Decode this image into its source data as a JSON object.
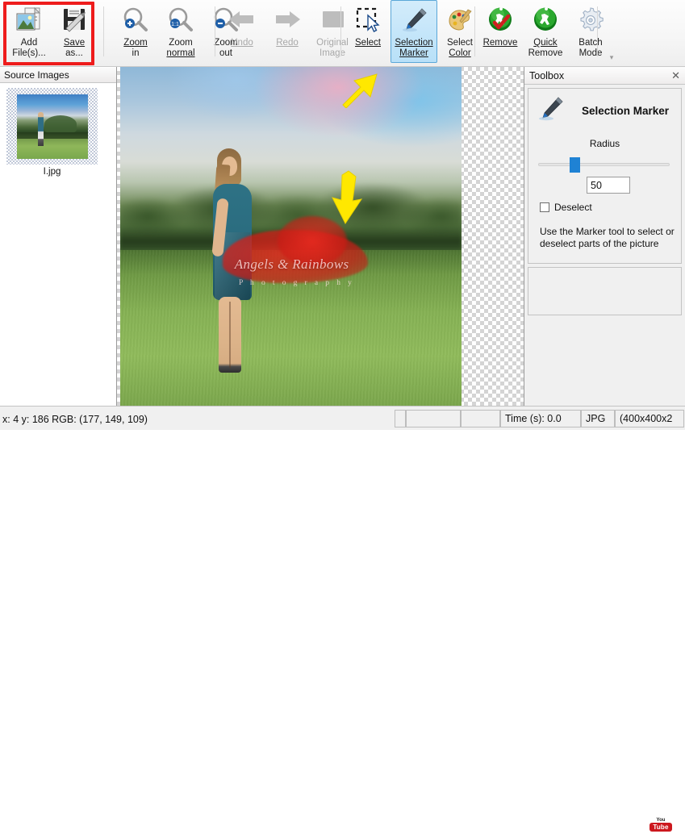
{
  "toolbar": {
    "buttons": [
      {
        "name": "add-files",
        "label1": "Add",
        "label2": "File(s)...",
        "icon": "add-image-icon",
        "state": "normal"
      },
      {
        "name": "save-as",
        "label1": "Save",
        "label2": "as...",
        "icon": "floppy-disk-icon",
        "state": "normal"
      },
      {
        "name": "zoom-in",
        "label1": "Zoom",
        "label2": "in",
        "icon": "magnifier-plus-icon",
        "state": "normal"
      },
      {
        "name": "zoom-normal",
        "label1": "Zoom",
        "label2": "normal",
        "icon": "magnifier-normal-icon",
        "state": "normal"
      },
      {
        "name": "zoom-out",
        "label1": "Zoom",
        "label2": "out",
        "icon": "magnifier-minus-icon",
        "state": "normal"
      },
      {
        "name": "undo",
        "label1": "Undo",
        "label2": "",
        "icon": "undo-arrow-icon",
        "state": "disabled"
      },
      {
        "name": "redo",
        "label1": "Redo",
        "label2": "",
        "icon": "redo-arrow-icon",
        "state": "disabled"
      },
      {
        "name": "original-image",
        "label1": "Original",
        "label2": "Image",
        "icon": "image-placeholder-icon",
        "state": "disabled"
      },
      {
        "name": "select",
        "label1": "Select",
        "label2": "",
        "icon": "marquee-cursor-icon",
        "state": "normal"
      },
      {
        "name": "selection-marker",
        "label1": "Selection",
        "label2": "Marker",
        "icon": "marker-pen-icon",
        "state": "active"
      },
      {
        "name": "select-color",
        "label1": "Select",
        "label2": "Color",
        "icon": "color-palette-icon",
        "state": "normal"
      },
      {
        "name": "remove",
        "label1": "Remove",
        "label2": "",
        "icon": "green-runner-check-icon",
        "state": "normal"
      },
      {
        "name": "quick-remove",
        "label1": "Quick",
        "label2": "Remove",
        "icon": "green-runner-icon",
        "state": "normal"
      },
      {
        "name": "batch-mode",
        "label1": "Batch",
        "label2": "Mode",
        "icon": "gear-icon",
        "state": "normal"
      }
    ],
    "overflow_glyph": "▾",
    "highlight_color": "#ee1c1c"
  },
  "left_panel": {
    "title": "Source Images",
    "items": [
      {
        "filename": "I.jpg"
      }
    ]
  },
  "canvas": {
    "watermark_line1": "Angels & Rainbows",
    "watermark_line2": "P h o t o g r a p h y"
  },
  "right_panel": {
    "title": "Toolbox",
    "close_glyph": "✕",
    "tool_title": "Selection Marker",
    "tool_icon": "marker-pen-icon",
    "radius_label": "Radius",
    "radius_value": "50",
    "slider_percent": 24,
    "deselect_label": "Deselect",
    "deselect_checked": false,
    "hint_line1": "Use the Marker tool to select or",
    "hint_line2": "deselect parts of the picture"
  },
  "statusbar": {
    "coords": "x: 4 y: 186  RGB: (177, 149, 109)",
    "cells": [
      {
        "name": "status-cell-1",
        "text": ""
      },
      {
        "name": "status-cell-2",
        "text": ""
      },
      {
        "name": "status-cell-3",
        "text": ""
      },
      {
        "name": "status-cell-time",
        "text": "Time (s): 0.0"
      },
      {
        "name": "status-cell-format",
        "text": "JPG"
      },
      {
        "name": "status-cell-size",
        "text": "(400x400x2"
      }
    ],
    "watermark_top": "You",
    "watermark_badge": "Tube"
  }
}
